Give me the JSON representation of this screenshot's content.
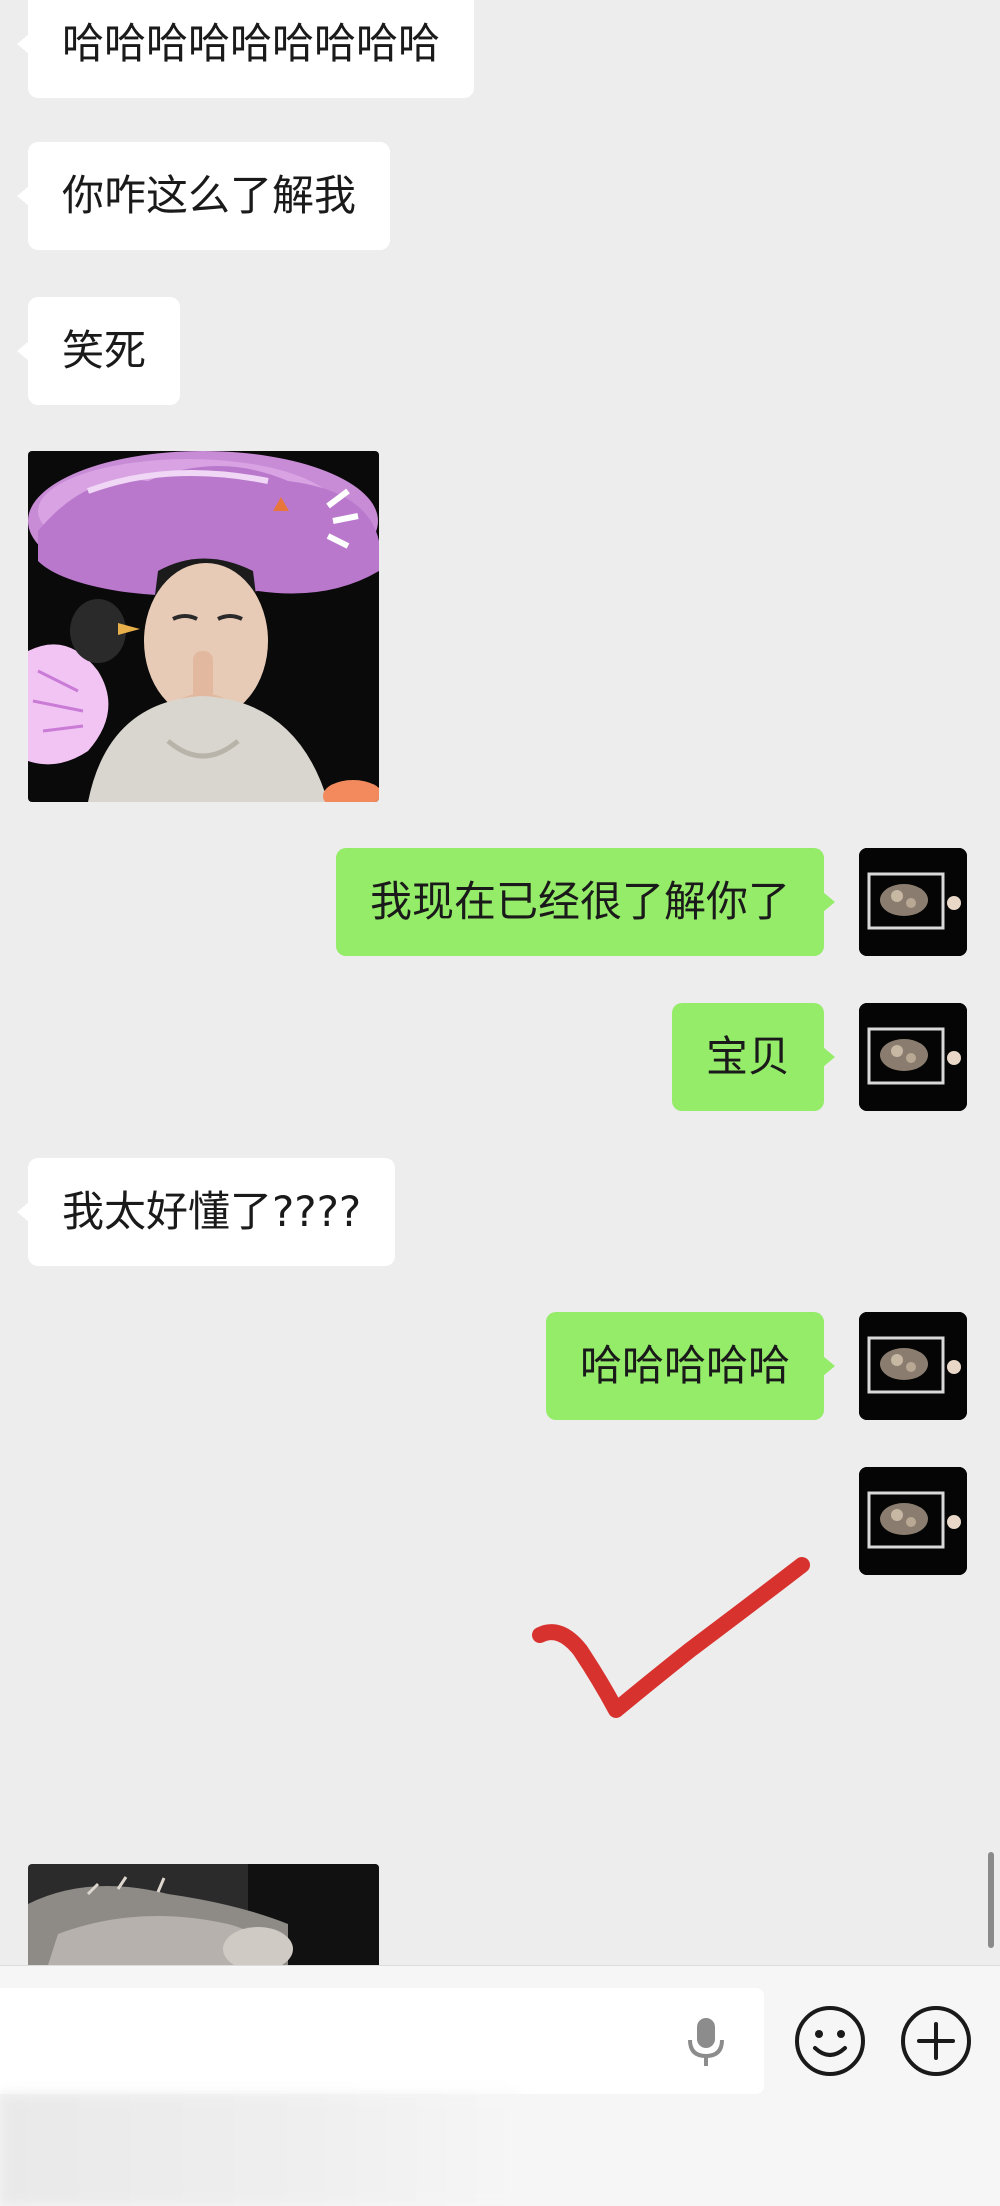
{
  "messages": [
    {
      "side": "left",
      "type": "text",
      "text": "哈哈哈哈哈哈哈哈哈"
    },
    {
      "side": "left",
      "type": "text",
      "text": "你咋这么了解我"
    },
    {
      "side": "left",
      "type": "text",
      "text": "笑死"
    },
    {
      "side": "left",
      "type": "sticker",
      "sticker": "boy-purple-hat-shush"
    },
    {
      "side": "right",
      "type": "text",
      "text": "我现在已经很了解你了"
    },
    {
      "side": "right",
      "type": "text",
      "text": "宝贝"
    },
    {
      "side": "left",
      "type": "text",
      "text": "我太好懂了????"
    },
    {
      "side": "right",
      "type": "text",
      "text": "哈哈哈哈哈"
    },
    {
      "side": "right",
      "type": "sticker",
      "sticker": "red-checkmark"
    },
    {
      "side": "left",
      "type": "sticker",
      "sticker": "cat-photo-partial"
    }
  ],
  "input_bar": {
    "icons": [
      "microphone-icon",
      "emoji-icon",
      "plus-icon"
    ]
  },
  "colors": {
    "background": "#ededed",
    "bubble_left": "#ffffff",
    "bubble_right": "#95ec69",
    "check_red": "#d8322f",
    "input_bar": "#f6f6f6"
  }
}
